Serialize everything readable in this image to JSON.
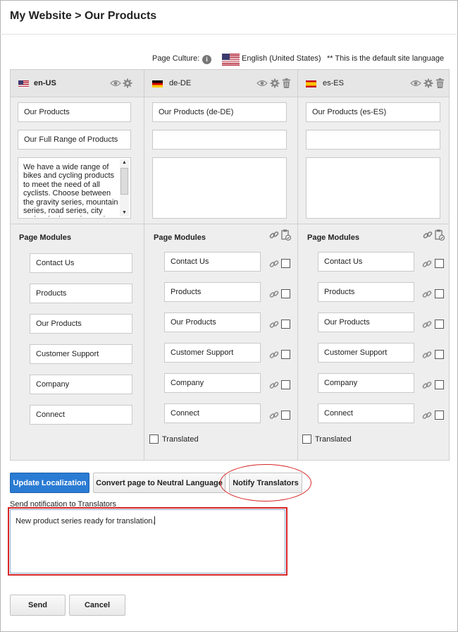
{
  "header": {
    "title": "My Website > Our Products"
  },
  "culture": {
    "label": "Page Culture:",
    "language": "English (United States)",
    "note": "** This is the default site language"
  },
  "columns": [
    {
      "code": "en-US",
      "title_value": "Our Products",
      "subtitle_value": "Our Full Range of Products",
      "description_value": "We have a wide range of bikes and cycling products to meet the need of all cyclists. Choose between the gravity series, mountain series, road series, city series, junior series and more."
    },
    {
      "code": "de-DE",
      "title_value": "Our Products (de-DE)",
      "subtitle_value": "",
      "description_value": ""
    },
    {
      "code": "es-ES",
      "title_value": "Our Products (es-ES)",
      "subtitle_value": "",
      "description_value": ""
    }
  ],
  "modules": {
    "label": "Page Modules",
    "items": [
      "Contact Us",
      "Products",
      "Our Products",
      "Customer Support",
      "Company",
      "Connect"
    ]
  },
  "translated_label": "Translated",
  "actions": {
    "update": "Update Localization",
    "convert": "Convert page to Neutral Language",
    "notify": "Notify Translators"
  },
  "notification": {
    "label": "Send notification to Translators",
    "value": "New product series ready for translation."
  },
  "footer": {
    "send": "Send",
    "cancel": "Cancel"
  },
  "colors": {
    "accent": "#2a7bd3",
    "highlight": "#d62424"
  }
}
